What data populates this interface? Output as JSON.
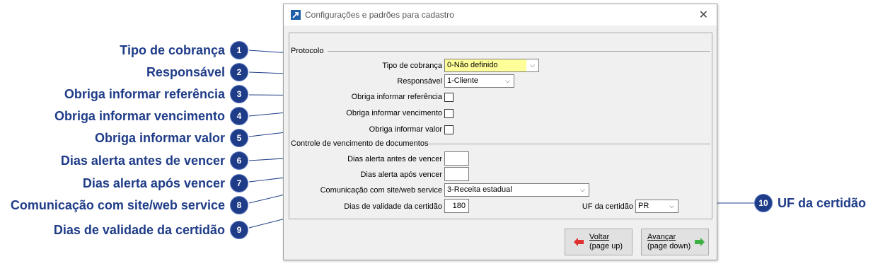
{
  "callouts": [
    {
      "num": "1",
      "label": "Tipo de cobrança"
    },
    {
      "num": "2",
      "label": "Responsável"
    },
    {
      "num": "3",
      "label": "Obriga informar referência"
    },
    {
      "num": "4",
      "label": "Obriga informar vencimento"
    },
    {
      "num": "5",
      "label": "Obriga informar valor"
    },
    {
      "num": "6",
      "label": "Dias alerta antes de vencer"
    },
    {
      "num": "7",
      "label": "Dias alerta após vencer"
    },
    {
      "num": "8",
      "label": "Comunicação com site/web service"
    },
    {
      "num": "9",
      "label": "Dias de validade da certidão"
    },
    {
      "num": "10",
      "label": "UF da certidão"
    }
  ],
  "dialog": {
    "title": "Configurações e padrões para cadastro",
    "close_glyph": "✕",
    "sections": {
      "protocolo": "Protocolo",
      "controle": "Controle de vencimento de documentos"
    },
    "fields": {
      "tipo_cobranca": {
        "label": "Tipo de cobrança",
        "value": "0-Não definido"
      },
      "responsavel": {
        "label": "Responsável",
        "value": "1-Cliente"
      },
      "obriga_referencia": {
        "label": "Obriga informar referência",
        "checked": false
      },
      "obriga_vencimento": {
        "label": "Obriga informar vencimento",
        "checked": false
      },
      "obriga_valor": {
        "label": "Obriga informar valor",
        "checked": false
      },
      "dias_antes": {
        "label": "Dias alerta antes de vencer",
        "value": ""
      },
      "dias_apos": {
        "label": "Dias alerta após vencer",
        "value": ""
      },
      "comunicacao": {
        "label": "Comunicação com site/web service",
        "value": "3-Receita estadual"
      },
      "dias_validade": {
        "label": "Dias de validade da certidão",
        "value": "180"
      },
      "uf_certidao": {
        "label": "UF da certidão",
        "value": "PR"
      }
    },
    "buttons": {
      "voltar": {
        "line1": "Voltar",
        "line2": "(page up)",
        "icon": "arrow-left-icon"
      },
      "avancar": {
        "line1": "Avançar",
        "line2": "(page down)",
        "icon": "arrow-right-icon"
      }
    },
    "colors": {
      "highlight_field": "#ffff99",
      "callout": "#1f3c88"
    }
  }
}
